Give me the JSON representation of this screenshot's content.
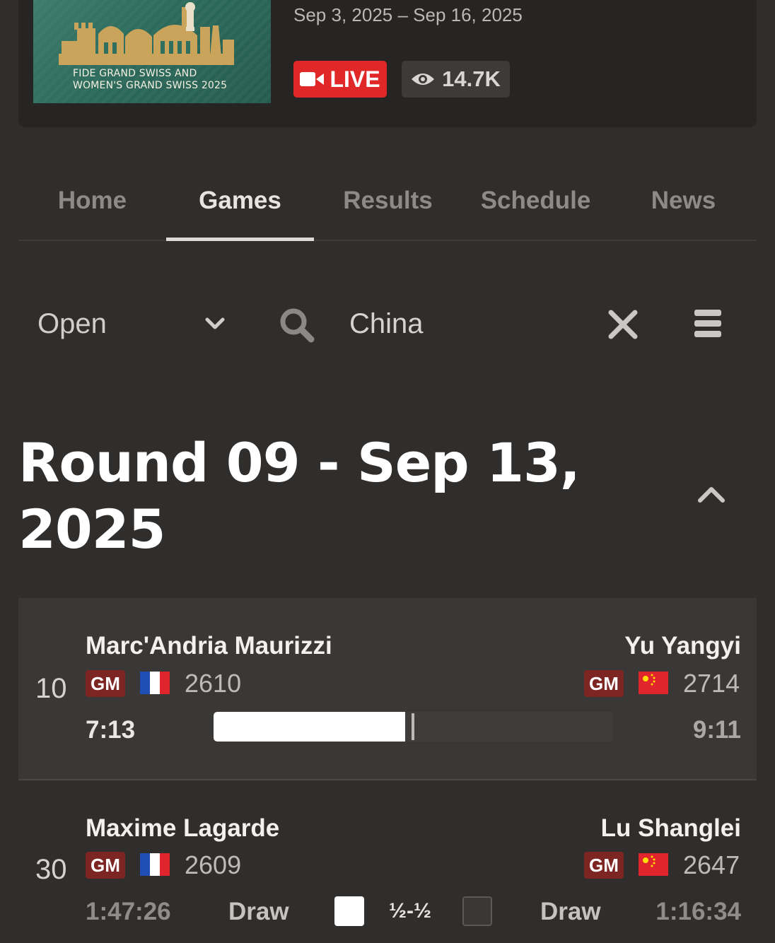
{
  "event": {
    "logo_text_line1": "FIDE GRAND SWISS AND",
    "logo_text_line2": "WOMEN'S GRAND SWISS 2025",
    "dates": "Sep 3, 2025 – Sep 16, 2025",
    "live_label": "LIVE",
    "viewers": "14.7K",
    "live_color": "#e02828"
  },
  "tabs": [
    {
      "label": "Home",
      "active": false
    },
    {
      "label": "Games",
      "active": true
    },
    {
      "label": "Results",
      "active": false
    },
    {
      "label": "Schedule",
      "active": false
    },
    {
      "label": "News",
      "active": false
    }
  ],
  "filters": {
    "section": "Open",
    "search_value": "China"
  },
  "round": {
    "title_line1": "Round 09 - Sep 13,",
    "title_line2": "2025"
  },
  "games": [
    {
      "board": "10",
      "white": {
        "name": "Marc'Andria Maurizzi",
        "title": "GM",
        "flag": "france-flag",
        "rating": "2610",
        "clock": "7:13"
      },
      "black": {
        "name": "Yu Yangyi",
        "title": "GM",
        "flag": "china-flag",
        "rating": "2714",
        "clock": "9:11"
      },
      "eval_white_fraction": 0.48
    },
    {
      "board": "30",
      "white": {
        "name": "Maxime Lagarde",
        "title": "GM",
        "flag": "france-flag",
        "rating": "2609",
        "clock": "1:47:26",
        "result": "Draw"
      },
      "black": {
        "name": "Lu Shanglei",
        "title": "GM",
        "flag": "china-flag",
        "rating": "2647",
        "clock": "1:16:34",
        "result": "Draw"
      },
      "score": "½-½"
    }
  ]
}
